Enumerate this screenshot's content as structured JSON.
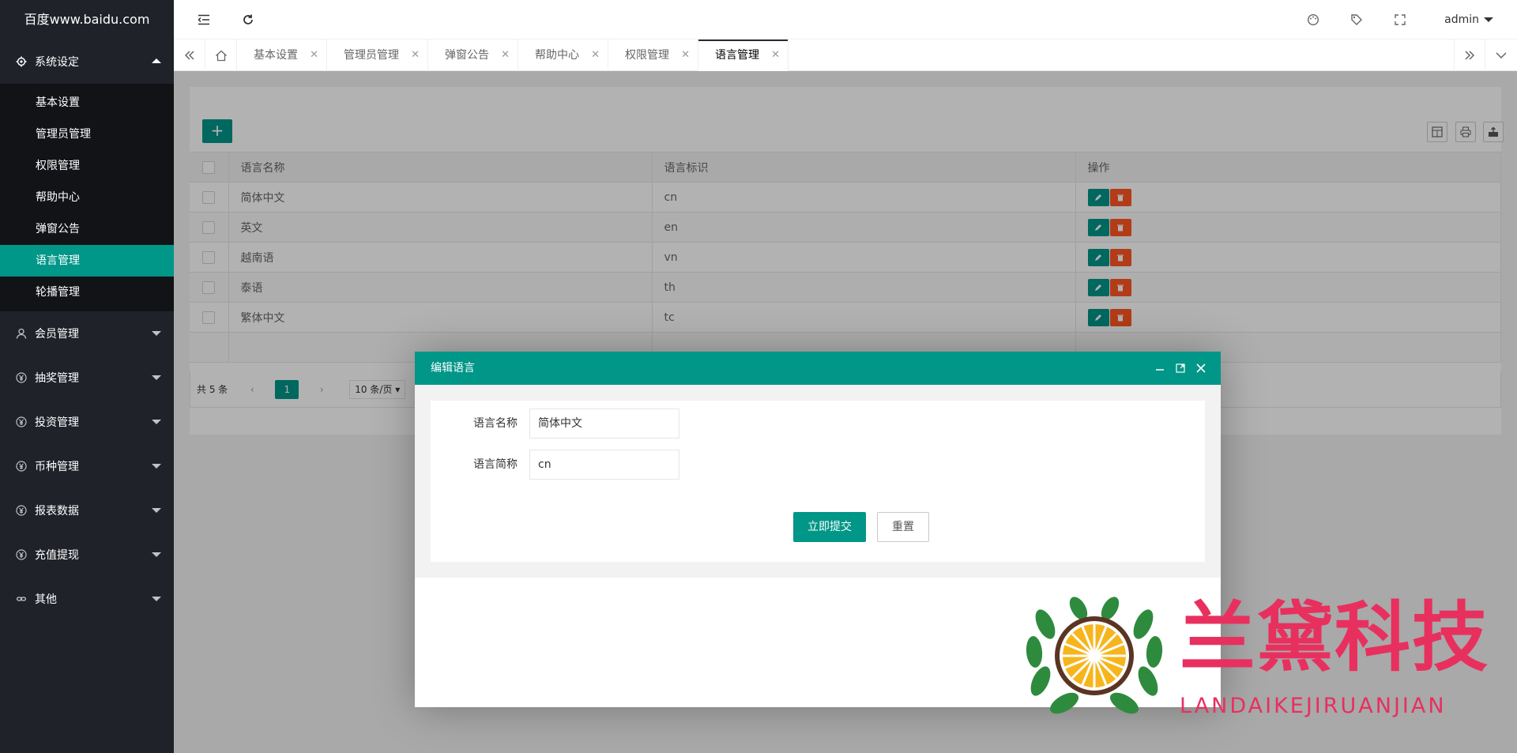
{
  "app": {
    "logo": "百度www.baidu.com",
    "user": "admin"
  },
  "sidebar": {
    "groups": [
      {
        "label": "系统设定",
        "icon": "gear-icon",
        "expanded": true,
        "items": [
          "基本设置",
          "管理员管理",
          "权限管理",
          "帮助中心",
          "弹窗公告",
          "语言管理",
          "轮播管理"
        ],
        "active": "语言管理"
      },
      {
        "label": "会员管理",
        "icon": "user-icon"
      },
      {
        "label": "抽奖管理",
        "icon": "yen-icon"
      },
      {
        "label": "投资管理",
        "icon": "yen-icon"
      },
      {
        "label": "币种管理",
        "icon": "yen-icon"
      },
      {
        "label": "报表数据",
        "icon": "yen-icon"
      },
      {
        "label": "充值提现",
        "icon": "yen-icon"
      },
      {
        "label": "其他",
        "icon": "link-icon"
      }
    ]
  },
  "tabs": [
    {
      "label": "基本设置"
    },
    {
      "label": "管理员管理"
    },
    {
      "label": "弹窗公告"
    },
    {
      "label": "帮助中心"
    },
    {
      "label": "权限管理"
    },
    {
      "label": "语言管理",
      "active": true
    }
  ],
  "table": {
    "headers": [
      "语言名称",
      "语言标识",
      "操作"
    ],
    "rows": [
      {
        "name": "简体中文",
        "code": "cn"
      },
      {
        "name": "英文",
        "code": "en"
      },
      {
        "name": "越南语",
        "code": "vn"
      },
      {
        "name": "泰语",
        "code": "th"
      },
      {
        "name": "繁体中文",
        "code": "tc"
      }
    ],
    "add_label": "+"
  },
  "pager": {
    "total": "共 5 条",
    "current": "1",
    "page_size": "10 条/页"
  },
  "modal": {
    "title": "编辑语言",
    "fields": [
      {
        "label": "语言名称",
        "value": "简体中文"
      },
      {
        "label": "语言简称",
        "value": "cn"
      }
    ],
    "submit": "立即提交",
    "reset": "重置"
  },
  "watermark": {
    "title": "兰黛科技",
    "subtitle": "LANDAIKEJIRUANJIAN"
  },
  "colors": {
    "primary": "#009688",
    "danger": "#ff5722",
    "sidebar": "#20222a",
    "watermark": "#e8305f"
  }
}
